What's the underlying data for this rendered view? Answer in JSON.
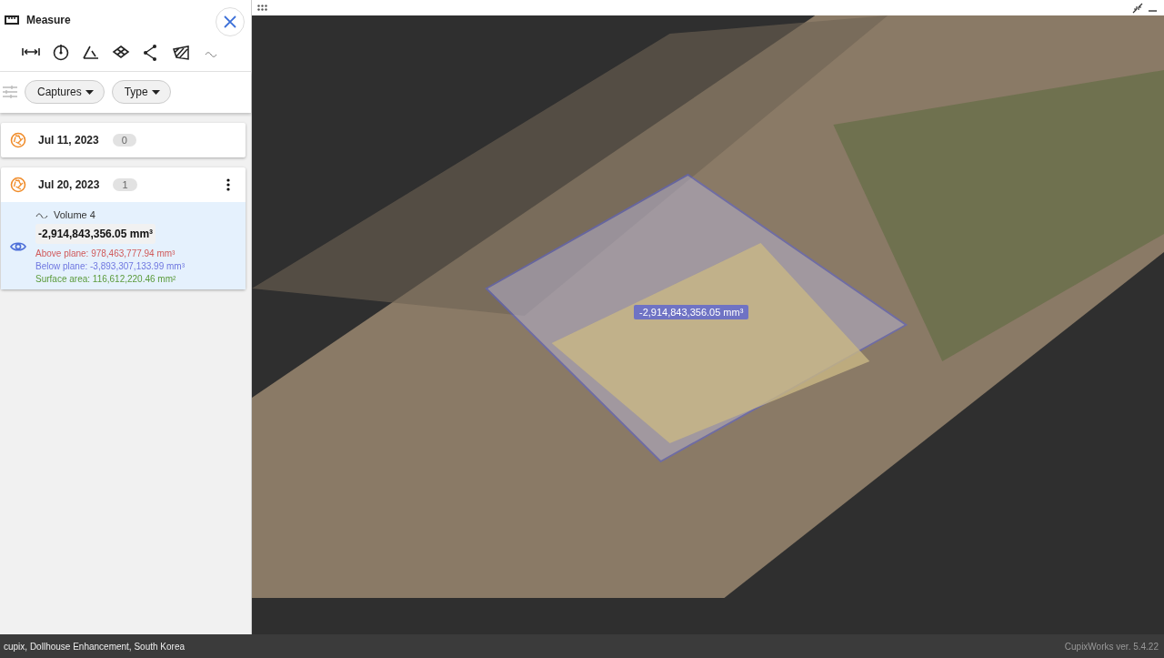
{
  "panel": {
    "title": "Measure",
    "tools": [
      {
        "kind": "distance"
      },
      {
        "kind": "height"
      },
      {
        "kind": "angle"
      },
      {
        "kind": "area"
      },
      {
        "kind": "polyline"
      },
      {
        "kind": "section"
      },
      {
        "kind": "volume"
      }
    ],
    "filters": [
      {
        "label": "Captures"
      },
      {
        "label": "Type"
      }
    ],
    "captures": [
      {
        "date": "Jul 11, 2023",
        "count": "0",
        "menu": false
      },
      {
        "date": "Jul 20, 2023",
        "count": "1",
        "menu": true,
        "measurements": [
          {
            "kind": "volume",
            "name": "Volume 4",
            "selected": true,
            "visible": true,
            "value": "-2,914,843,356.05 mm³",
            "above": "Above plane: 978,463,777.94 mm³",
            "below": "Below plane: -3,893,307,133.99 mm³",
            "surface": "Surface area: 116,612,220.46 mm²"
          }
        ]
      }
    ]
  },
  "viewer": {
    "volume_label": "-2,914,843,356.05 mm³"
  },
  "status_bar": {
    "location": "cupix, Dollhouse Enhancement, South Korea",
    "version": "CupixWorks ver. 5.4.22"
  }
}
